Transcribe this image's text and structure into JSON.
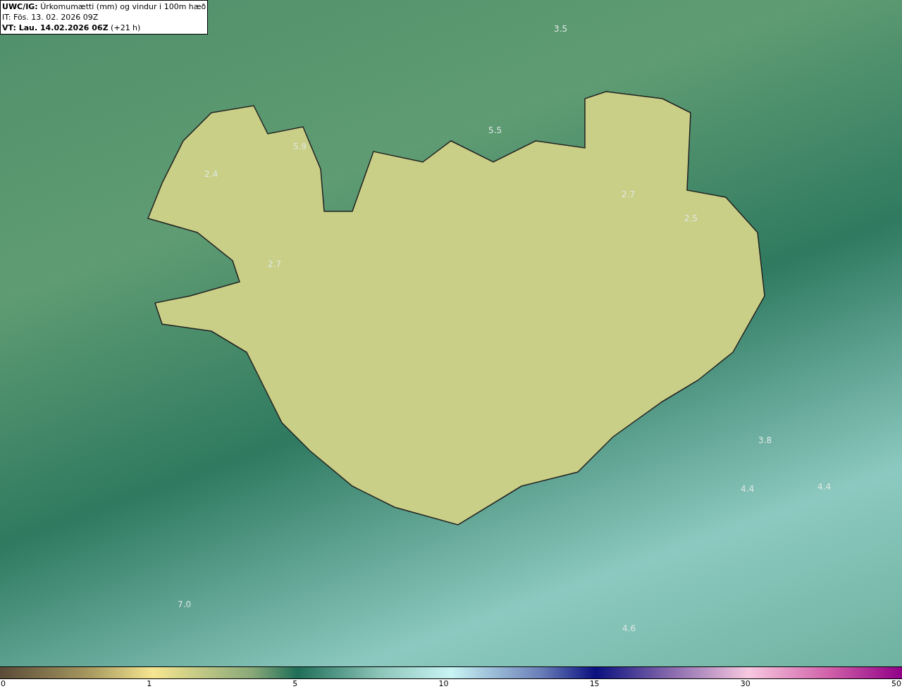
{
  "header": {
    "title": "**UWC/IG:** Úrkomumætti (mm) og vindur i 100m hæð",
    "issue_time": "IT: Fös. 13. 02. 2026 09Z",
    "valid_time": "**VT: Lau. 14.02.2026 06Z** (+21 h)"
  },
  "map": {
    "labels": [
      "3.5",
      "5.5",
      "5.9",
      "2.4",
      "2.7",
      "2.5",
      "2.7",
      "3.8",
      "4.4",
      "4.4",
      "7.0",
      "4.6"
    ]
  },
  "colorbar": {
    "ticks": [
      "0",
      "1",
      "5",
      "10",
      "15",
      "30",
      "50"
    ]
  }
}
